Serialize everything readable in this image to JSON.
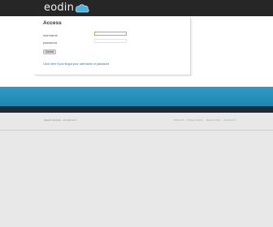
{
  "header": {
    "logo_text": "eodin",
    "logo_icon": "cloud-icon",
    "colors": {
      "bar": "#262626",
      "cloud": "#4fb3e0"
    }
  },
  "login": {
    "title": "Access",
    "username_label": "username",
    "password_label": "password",
    "username_value": "",
    "password_value": "",
    "login_button": "Submit",
    "forgot_link": "Click here if you forgot your username or password"
  },
  "footer": {
    "copyright": "Eqodin (Hestre) - all right cool",
    "links": [
      "About Us",
      "Privacy Notice",
      "Terms of Use",
      "Contact Us"
    ],
    "colors": {
      "band": "#2a93be",
      "band_dark": "#1f2a32",
      "background": "#e8e8e8"
    }
  }
}
